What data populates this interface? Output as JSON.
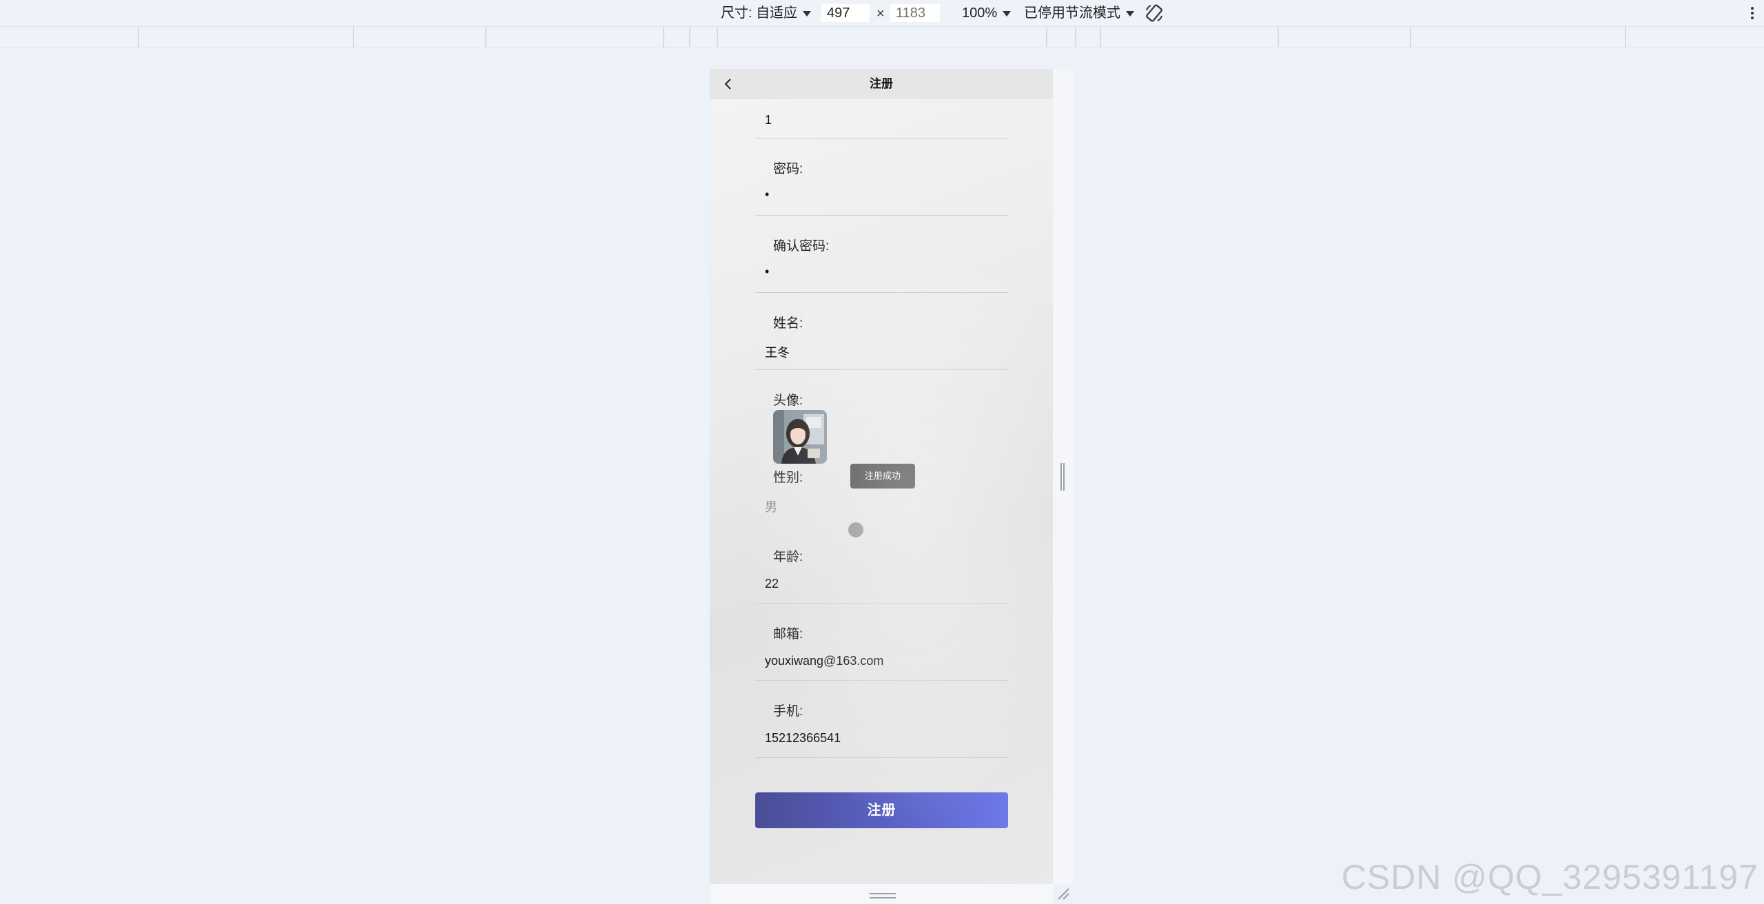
{
  "devtools": {
    "size_label": "尺寸: 自适应",
    "width": "497",
    "height_placeholder": "1183",
    "times": "×",
    "zoom": "100%",
    "throttle": "已停用节流模式"
  },
  "nav": {
    "title": "注册"
  },
  "form": {
    "account_value": "1",
    "password_label": "密码:",
    "password_value": "•",
    "confirm_label": "确认密码:",
    "confirm_value": "•",
    "name_label": "姓名:",
    "name_value": "王冬",
    "avatar_label": "头像:",
    "gender_label": "性别:",
    "gender_value": "男",
    "age_label": "年龄:",
    "age_value": "22",
    "email_label": "邮箱:",
    "email_value": "youxiwang@163.com",
    "phone_label": "手机:",
    "phone_value": "15212366541",
    "submit_label": "注册"
  },
  "toast": {
    "text": "注册成功"
  },
  "watermark": "CSDN @QQ_3295391197"
}
